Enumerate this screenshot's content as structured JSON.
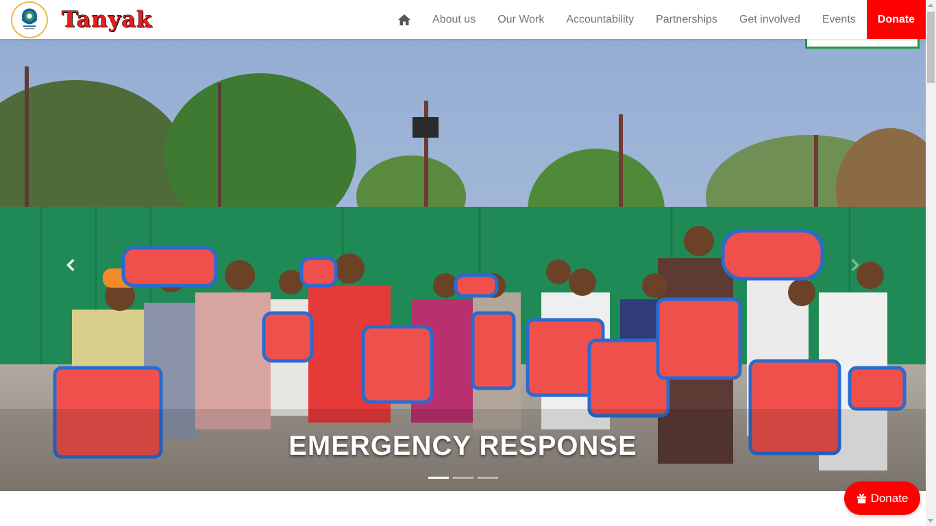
{
  "brand": {
    "name": "Tanyak",
    "logo_icon": "tanyak-logo-icon"
  },
  "nav": {
    "home_icon": "home-icon",
    "items": [
      {
        "label": "About us"
      },
      {
        "label": "Our Work"
      },
      {
        "label": "Accountability"
      },
      {
        "label": "Partnerships"
      },
      {
        "label": "Get involved"
      },
      {
        "label": "Events"
      }
    ],
    "donate_label": "Donate"
  },
  "carousel": {
    "caption": "EMERGENCY RESPONSE",
    "slide_count": 3,
    "active_index": 0,
    "prev_icon": "chevron-left-icon",
    "next_icon": "chevron-right-icon"
  },
  "floating_donate": {
    "label": "Donate",
    "icon": "gift-icon"
  },
  "colors": {
    "donate_red": "#ff0000",
    "brand_red": "#e51d1d",
    "nav_text": "#757575",
    "partner_green": "#1f9a3a"
  }
}
